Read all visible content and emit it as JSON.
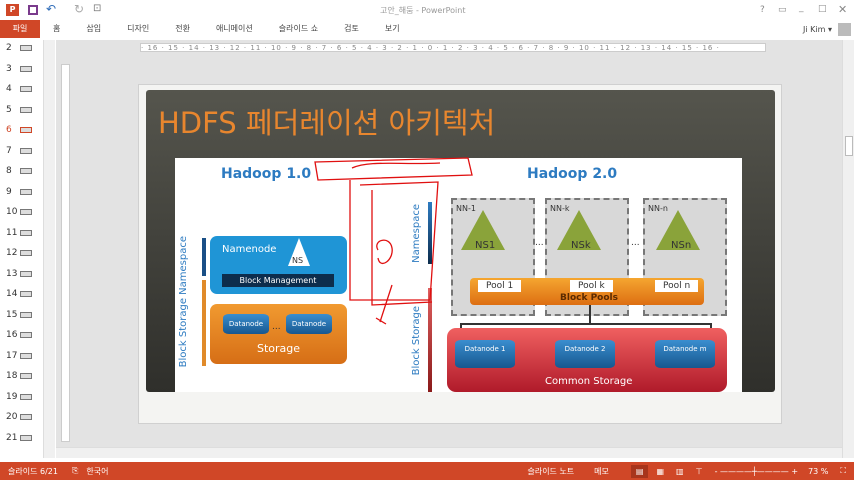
{
  "titlebar": {
    "filename": "고안_해둠 -",
    "app": "PowerPoint",
    "help": "?",
    "user": "Ji Kim ▾"
  },
  "tabs": [
    "파일",
    "홈",
    "삽입",
    "디자인",
    "전환",
    "애니메이션",
    "슬라이드 쇼",
    "검토",
    "보기"
  ],
  "thumbnails": [
    "2",
    "3",
    "4",
    "5",
    "6",
    "7",
    "8",
    "9",
    "10",
    "11",
    "12",
    "13",
    "14",
    "15",
    "16",
    "17",
    "18",
    "19",
    "20",
    "21"
  ],
  "selected_slide": "6",
  "ruler": "· 16 · 15 · 14 · 13 · 12 · 11 · 10 · 9 · 8 · 7 · 6 · 5 · 4 · 3 · 2 · 1 · 0 · 1 · 2 · 3 · 4 · 5 · 6 · 7 · 8 · 9 · 10 · 11 · 12 · 13 · 14 · 15 · 16 ·",
  "slide": {
    "title": "HDFS 페더레이션 아키텍처",
    "h1": {
      "title": "Hadoop 1.0",
      "namespace": "Namespace",
      "block_storage": "Block Storage",
      "namenode": "Namenode",
      "ns": "NS",
      "block_mgmt": "Block Management",
      "datanode": "Datanode",
      "dots": "...",
      "storage": "Storage"
    },
    "h2": {
      "title": "Hadoop 2.0",
      "namespace": "Namespace",
      "block_storage": "Block Storage",
      "nns": [
        {
          "label": "NN-1",
          "ns": "NS1",
          "pool": "Pool 1"
        },
        {
          "label": "NN-k",
          "ns": "NSk",
          "pool": "Pool k"
        },
        {
          "label": "NN-n",
          "ns": "NSn",
          "pool": "Pool n"
        }
      ],
      "dots": "...",
      "block_pools": "Block Pools",
      "datanodes": [
        "Datanode 1",
        "Datanode 2",
        "Datanode m"
      ],
      "common_storage": "Common Storage"
    }
  },
  "status": {
    "slide": "슬라이드 6/21",
    "lang": "한국어",
    "notes": "슬라이드 노트",
    "comments": "메모",
    "zoom": "73 %"
  }
}
